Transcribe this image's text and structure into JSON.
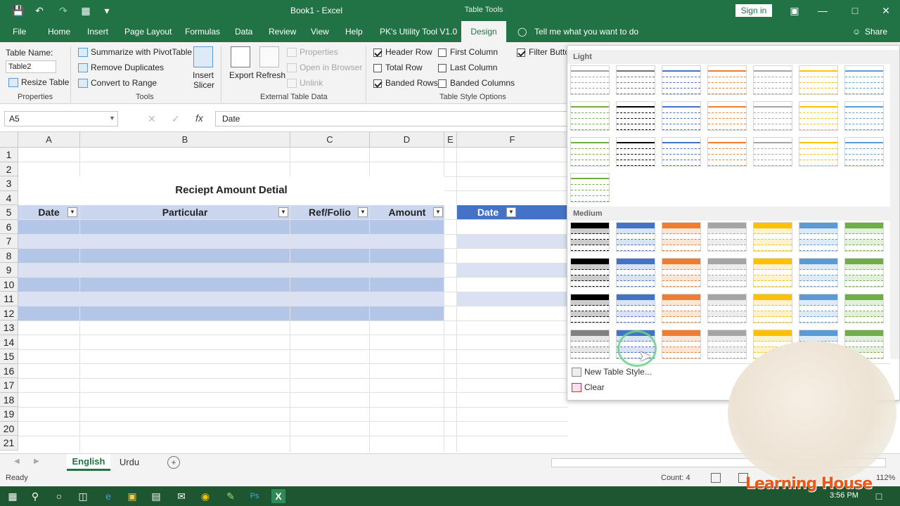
{
  "window": {
    "title": "Book1  -  Excel",
    "context_tab_group": "Table Tools",
    "signin": "Sign in"
  },
  "menu_tabs": [
    "File",
    "Home",
    "Insert",
    "Page Layout",
    "Formulas",
    "Data",
    "Review",
    "View",
    "Help",
    "PK's Utility Tool V1.0",
    "Design"
  ],
  "active_tab": "Design",
  "tell_me": "Tell me what you want to do",
  "share": "Share",
  "ribbon": {
    "properties": {
      "label": "Table Name:",
      "value": "Table2",
      "resize": "Resize Table",
      "group": "Properties"
    },
    "tools": {
      "summarize": "Summarize with PivotTable",
      "remove_dup": "Remove Duplicates",
      "convert": "Convert to Range",
      "insert_slicer_1": "Insert",
      "insert_slicer_2": "Slicer",
      "group": "Tools"
    },
    "external": {
      "export": "Export",
      "refresh": "Refresh",
      "properties": "Properties",
      "open_browser": "Open in Browser",
      "unlink": "Unlink",
      "group": "External Table Data"
    },
    "style_options": {
      "header_row": "Header Row",
      "total_row": "Total Row",
      "banded_rows": "Banded Rows",
      "first_column": "First Column",
      "last_column": "Last Column",
      "banded_columns": "Banded Columns",
      "filter_button": "Filter Butto",
      "group": "Table Style Options"
    }
  },
  "checks": {
    "header_row": true,
    "total_row": false,
    "banded_rows": true,
    "first_column": false,
    "last_column": false,
    "banded_columns": false,
    "filter_button": true
  },
  "formula_bar": {
    "name_box": "A5",
    "formula": "Date"
  },
  "columns": [
    "A",
    "B",
    "C",
    "D",
    "E",
    "F"
  ],
  "rows": [
    "1",
    "2",
    "3",
    "4",
    "5",
    "6",
    "7",
    "8",
    "9",
    "10",
    "11",
    "12",
    "13",
    "14",
    "15",
    "16",
    "17",
    "18",
    "19",
    "20",
    "21"
  ],
  "sheet": {
    "title": "Reciept Amount Detial",
    "headers": [
      "Date",
      "Particular",
      "Ref/Folio",
      "Amount"
    ],
    "header2": "Date"
  },
  "gallery": {
    "light": "Light",
    "medium": "Medium",
    "new_style": "New Table Style...",
    "clear": "Clear",
    "light_colors": [
      "#9e9e9e",
      "#6f6f6f",
      "#4472c4",
      "#ed7d31",
      "#a5a5a5",
      "#ffc000",
      "#5b9bd5",
      "#70ad47",
      "#000000",
      "#4472c4",
      "#ed7d31",
      "#a5a5a5",
      "#ffc000",
      "#5b9bd5",
      "#70ad47",
      "#000000",
      "#4472c4",
      "#ed7d31",
      "#a5a5a5",
      "#ffc000",
      "#5b9bd5",
      "#70ad47"
    ],
    "medium_colors": [
      "#000000",
      "#4472c4",
      "#ed7d31",
      "#a5a5a5",
      "#ffc000",
      "#5b9bd5",
      "#70ad47",
      "#000000",
      "#4472c4",
      "#ed7d31",
      "#a5a5a5",
      "#ffc000",
      "#5b9bd5",
      "#70ad47",
      "#000000",
      "#4472c4",
      "#ed7d31",
      "#a5a5a5",
      "#ffc000",
      "#5b9bd5",
      "#70ad47",
      "#808080",
      "#4472c4",
      "#ed7d31",
      "#a5a5a5",
      "#ffc000",
      "#5b9bd5",
      "#70ad47"
    ]
  },
  "sheet_tabs": [
    "English",
    "Urdu"
  ],
  "active_sheet": "English",
  "status": {
    "ready": "Ready",
    "count": "Count: 4",
    "zoom": "112%",
    "time": "3:56 PM"
  },
  "watermark": "Learning House",
  "colors": {
    "accent": "#217346",
    "table_band": "#d9e1f2",
    "table_header": "#c9d6ee",
    "table_header_dark": "#4472c4"
  }
}
